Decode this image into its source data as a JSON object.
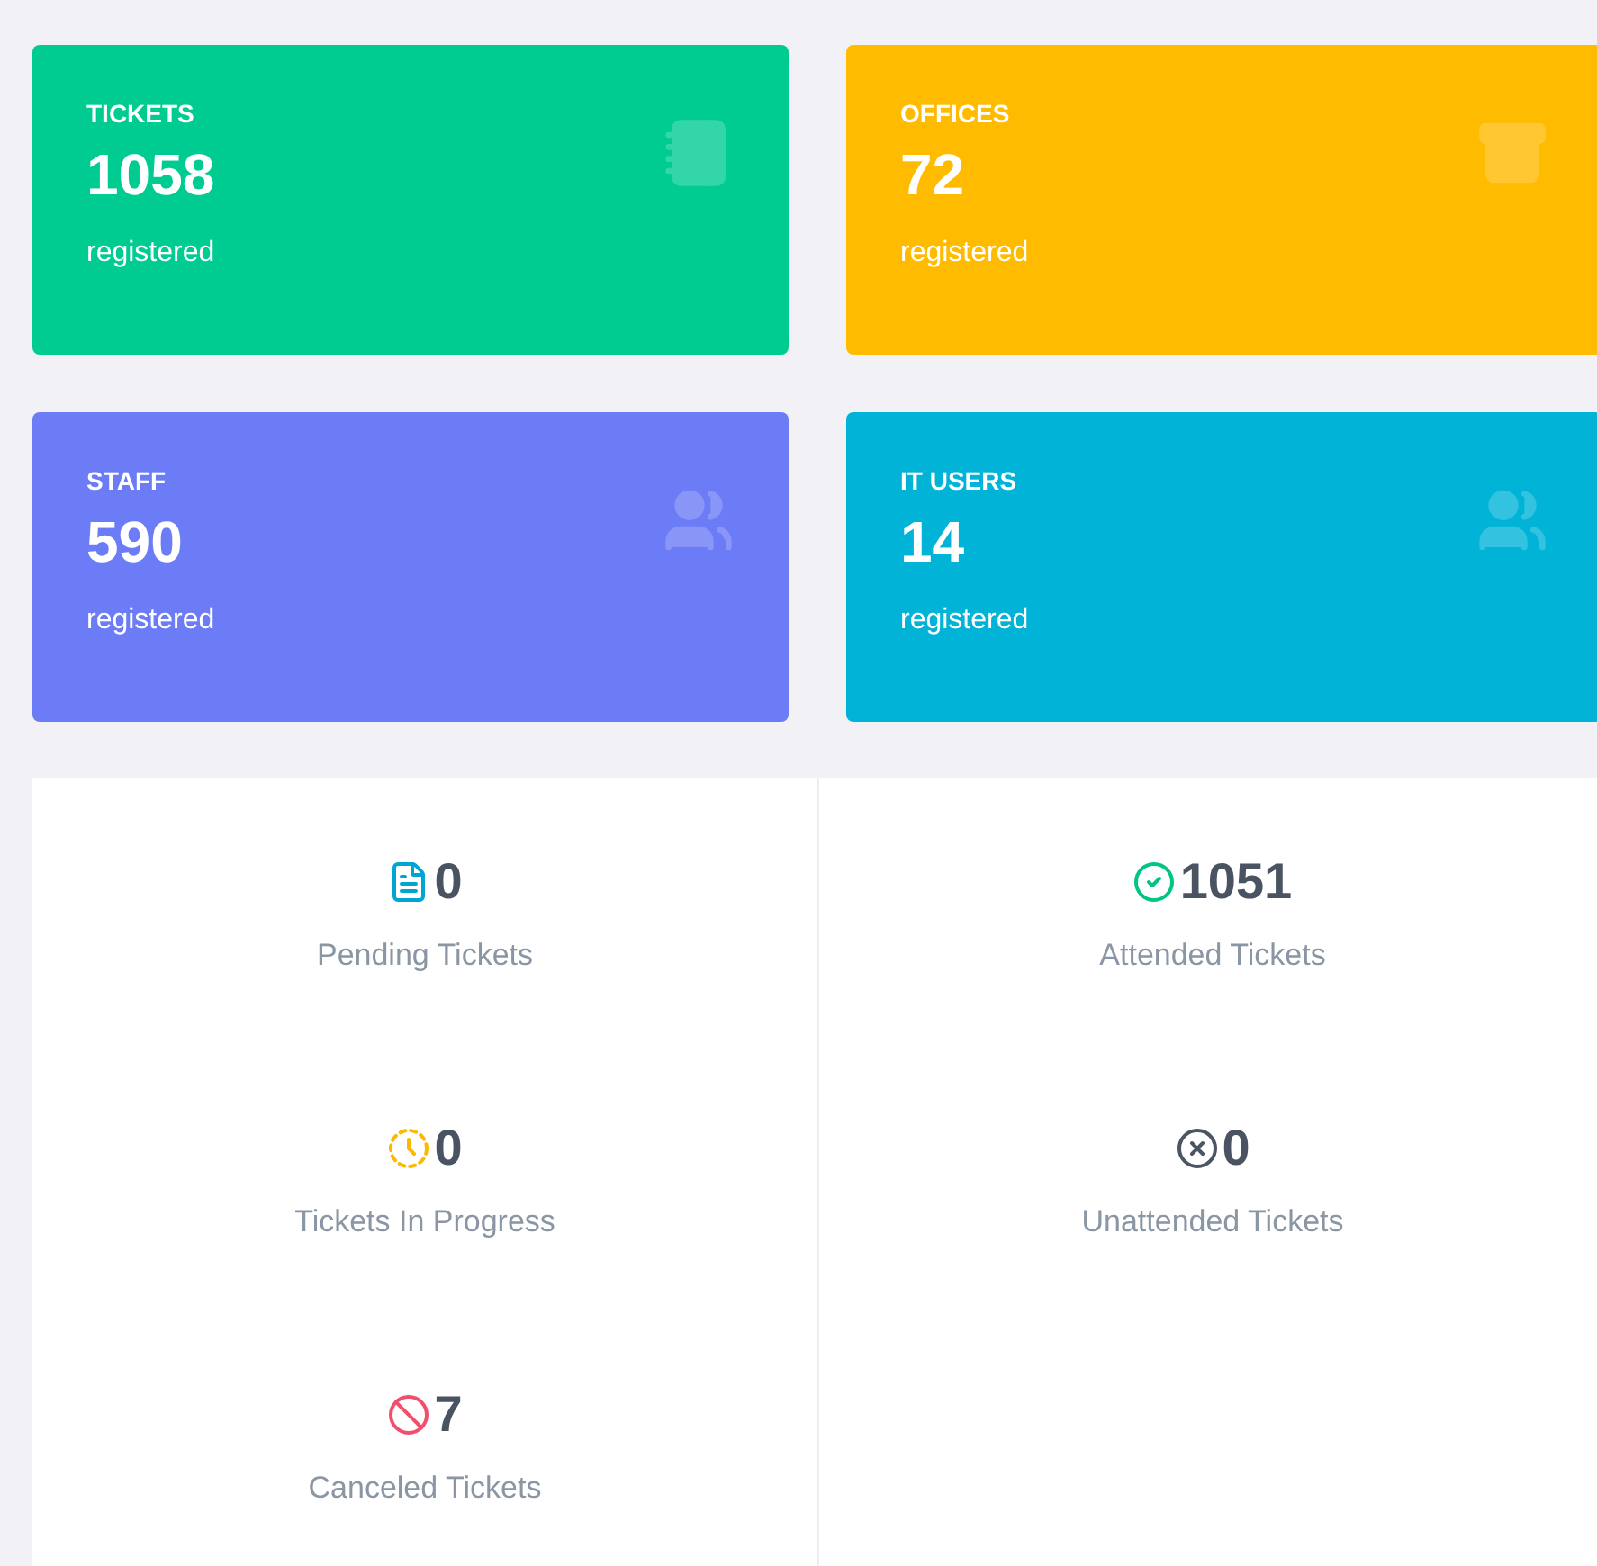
{
  "summary_cards": [
    {
      "title": "TICKETS",
      "count": "1058",
      "caption": "registered",
      "kind": "notebook",
      "color": "#00cc92"
    },
    {
      "title": "OFFICES",
      "count": "72",
      "caption": "registered",
      "kind": "archive",
      "color": "#ffbb00"
    },
    {
      "title": "STAFF",
      "count": "590",
      "caption": "registered",
      "kind": "users",
      "color": "#6b7cf6"
    },
    {
      "title": "IT USERS",
      "count": "14",
      "caption": "registered",
      "kind": "users",
      "color": "#00b3d7"
    }
  ],
  "ticket_stats": [
    {
      "value": "0",
      "label": "Pending Tickets",
      "kind": "pending"
    },
    {
      "value": "1051",
      "label": "Attended Tickets",
      "kind": "attended"
    },
    {
      "value": "0",
      "label": "Tickets In Progress",
      "kind": "progress"
    },
    {
      "value": "0",
      "label": "Unattended Tickets",
      "kind": "unattended"
    },
    {
      "value": "7",
      "label": "Canceled Tickets",
      "kind": "canceled"
    }
  ]
}
